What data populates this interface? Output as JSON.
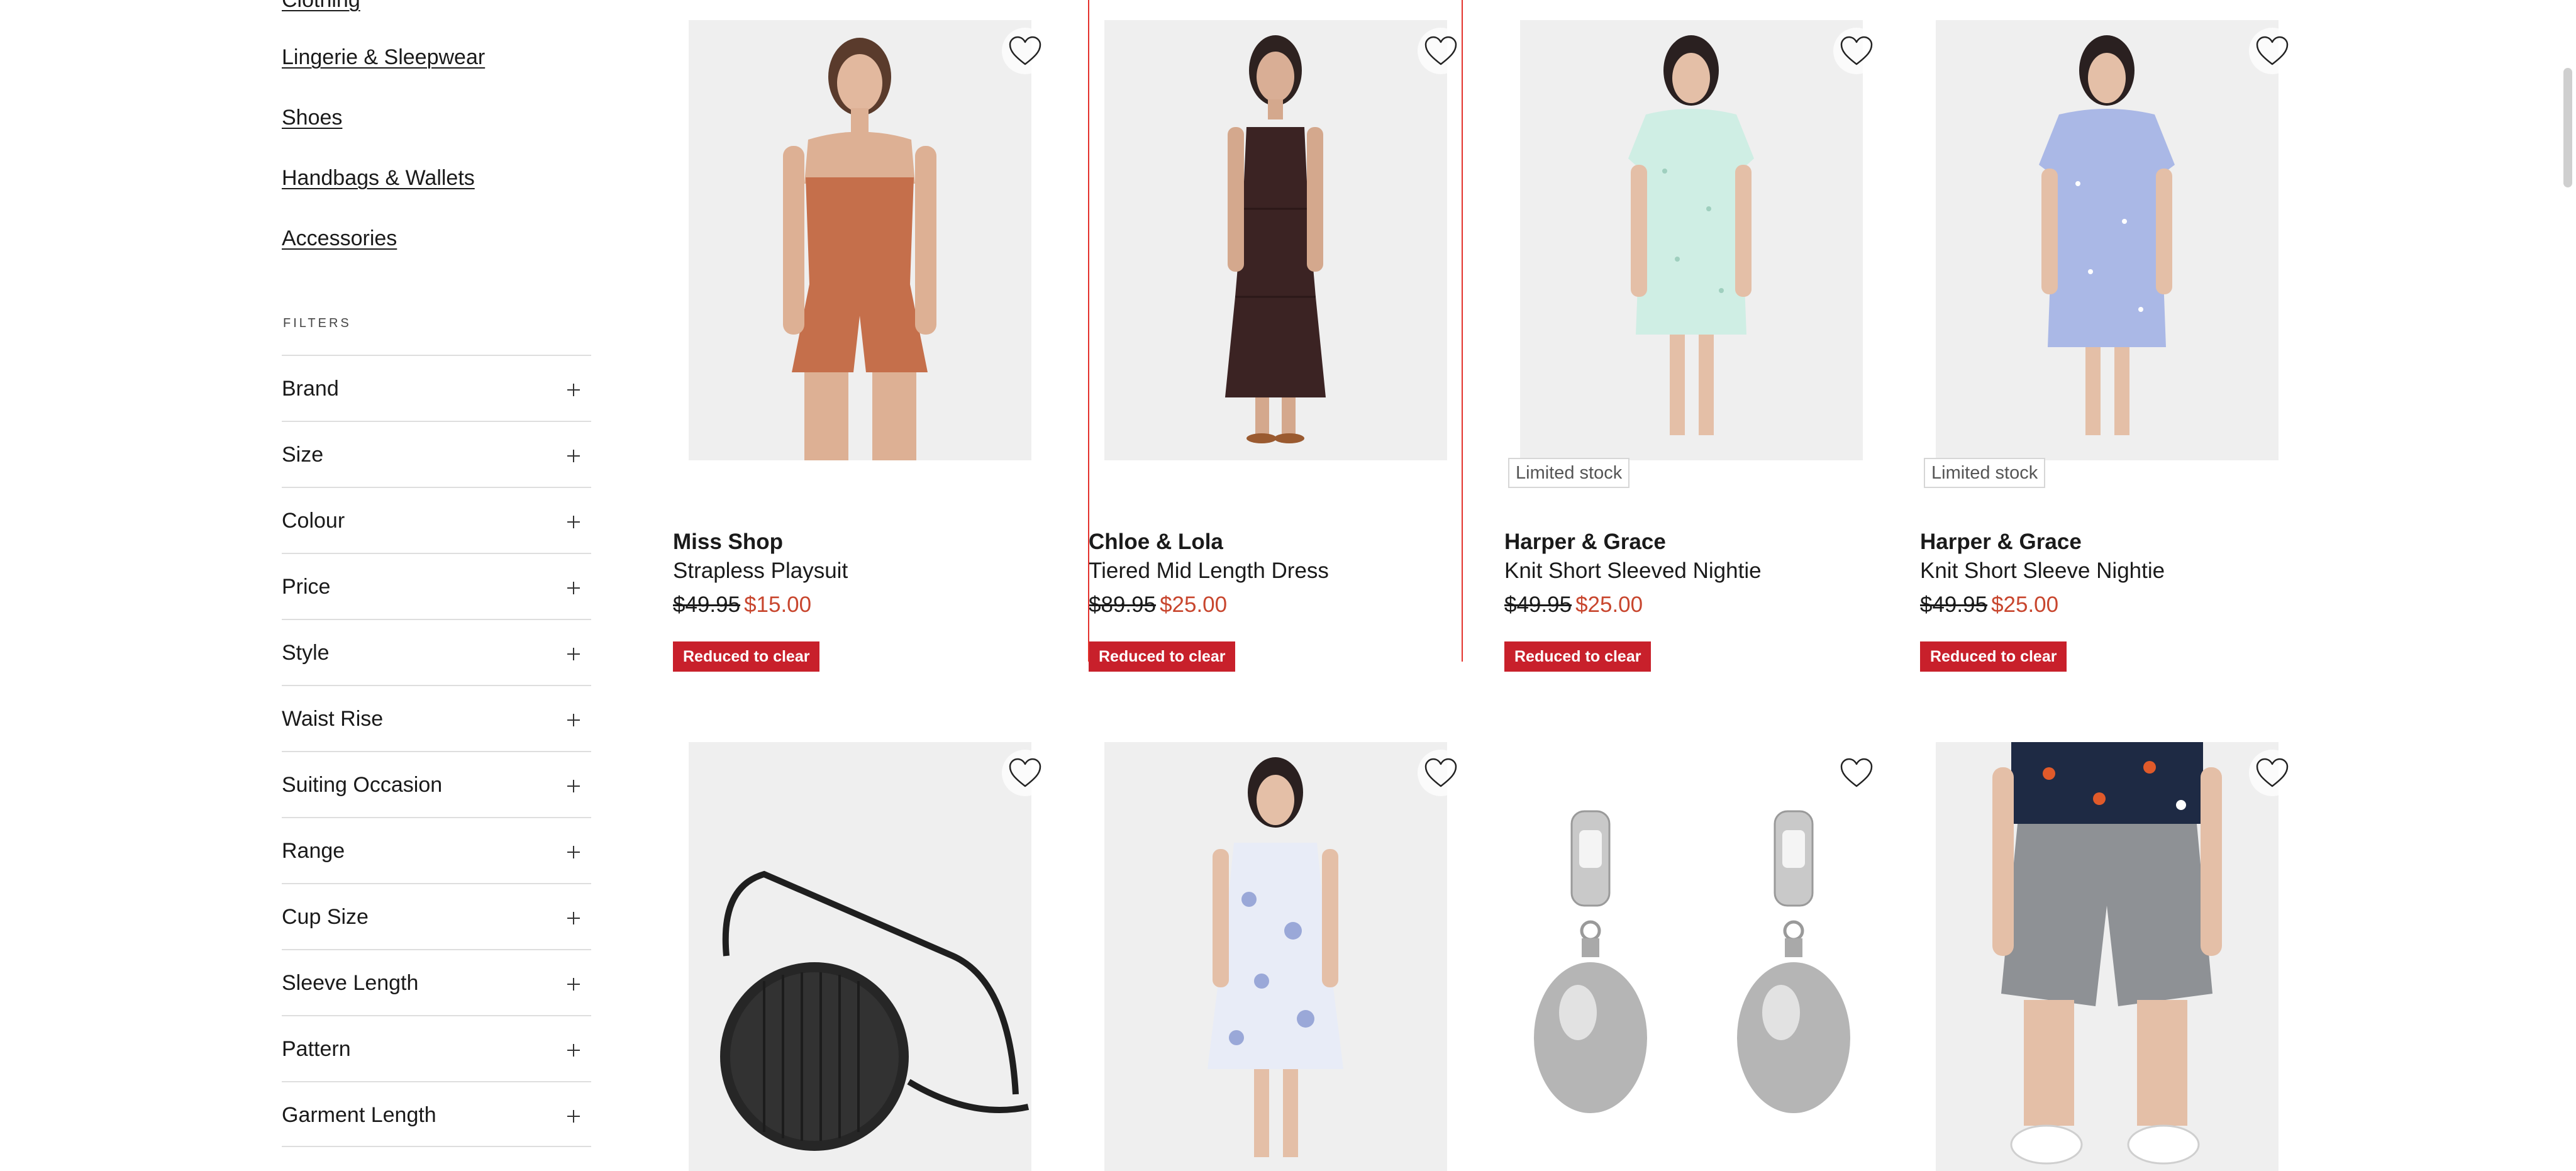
{
  "categories": [
    "Clothing",
    "Lingerie & Sleepwear",
    "Shoes",
    "Handbags & Wallets",
    "Accessories"
  ],
  "filters_heading": "FILTERS",
  "filters": [
    "Brand",
    "Size",
    "Colour",
    "Price",
    "Style",
    "Waist Rise",
    "Suiting Occasion",
    "Range",
    "Cup Size",
    "Sleeve Length",
    "Pattern",
    "Garment Length"
  ],
  "products": [
    {
      "brand": "Miss Shop",
      "name": "Strapless Playsuit",
      "was_price": "$49.95",
      "now_price": "$15.00",
      "promo": "Reduced to clear",
      "stock": "",
      "image": "strapless-playsuit-photo"
    },
    {
      "brand": "Chloe & Lola",
      "name": "Tiered Mid Length Dress",
      "was_price": "$89.95",
      "now_price": "$25.00",
      "promo": "Reduced to clear",
      "stock": "",
      "image": "tiered-dress-photo"
    },
    {
      "brand": "Harper & Grace",
      "name": "Knit Short Sleeved Nightie",
      "was_price": "$49.95",
      "now_price": "$25.00",
      "promo": "Reduced to clear",
      "stock": "Limited stock",
      "image": "mint-nightie-photo"
    },
    {
      "brand": "Harper & Grace",
      "name": "Knit Short Sleeve Nightie",
      "was_price": "$49.95",
      "now_price": "$25.00",
      "promo": "Reduced to clear",
      "stock": "Limited stock",
      "image": "blue-nightie-photo"
    },
    {
      "image": "round-crossbody-bag-photo"
    },
    {
      "image": "sleeveless-floral-nightie-photo"
    },
    {
      "image": "pearl-drop-earrings-photo"
    },
    {
      "image": "linen-shorts-photo"
    }
  ],
  "icons": {
    "wishlist": "heart-outline-icon",
    "expand": "plus-icon"
  },
  "colors": {
    "sale_price": "#c8462e",
    "promo_badge": "#c8202b",
    "hover_outline": "#e4312b"
  }
}
